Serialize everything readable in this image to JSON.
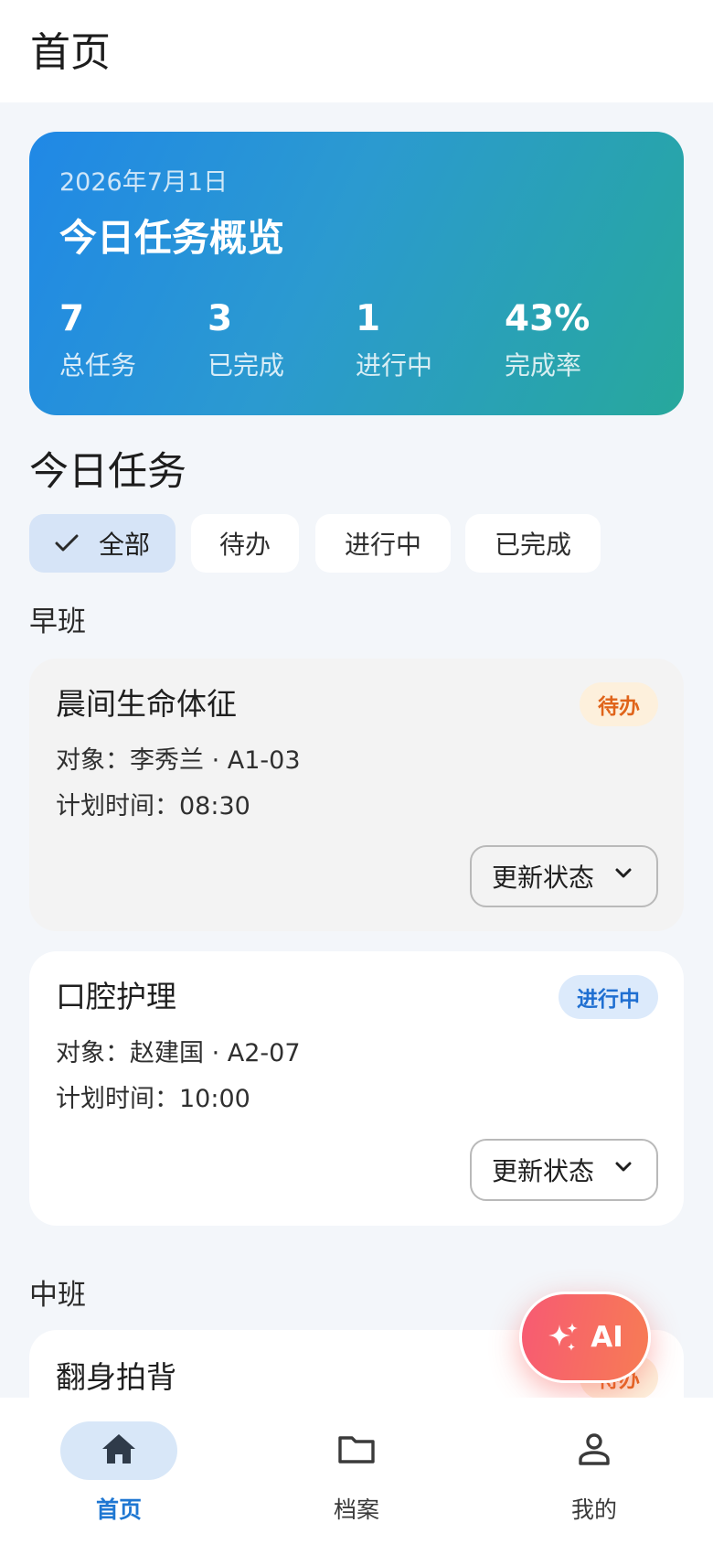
{
  "header": {
    "title": "首页"
  },
  "summary": {
    "date": "2026年7月1日",
    "heading": "今日任务概览",
    "stats": [
      {
        "value": "7",
        "label": "总任务"
      },
      {
        "value": "3",
        "label": "已完成"
      },
      {
        "value": "1",
        "label": "进行中"
      },
      {
        "value": "43%",
        "label": "完成率"
      }
    ]
  },
  "tasks_section": {
    "title": "今日任务",
    "filters": [
      {
        "label": "全部",
        "selected": true
      },
      {
        "label": "待办",
        "selected": false
      },
      {
        "label": "进行中",
        "selected": false
      },
      {
        "label": "已完成",
        "selected": false
      }
    ]
  },
  "groups": [
    {
      "label": "早班",
      "tasks": [
        {
          "name": "晨间生命体征",
          "status": "待办",
          "subject": "对象：李秀兰 · A1-03",
          "time": "计划时间：08:30",
          "action": "更新状态"
        },
        {
          "name": "口腔护理",
          "status": "进行中",
          "subject": "对象：赵建国 · A2-07",
          "time": "计划时间：10:00",
          "action": "更新状态"
        }
      ]
    },
    {
      "label": "中班",
      "tasks": [
        {
          "name": "翻身拍背",
          "status": "待办"
        }
      ]
    }
  ],
  "fab": {
    "label": "AI"
  },
  "bottom_nav": {
    "items": [
      {
        "label": "首页",
        "icon": "home-icon",
        "active": true
      },
      {
        "label": "档案",
        "icon": "folder-icon",
        "active": false
      },
      {
        "label": "我的",
        "icon": "person-icon",
        "active": false
      }
    ]
  },
  "colors": {
    "accent": "#1f77d2",
    "background": "#f3f6fa",
    "summary_gradient_start": "#2088e6",
    "summary_gradient_end": "#27a89c",
    "todo_badge": "#e0641a",
    "doing_badge": "#1f6fd1",
    "fab_gradient_start": "#f75a73",
    "fab_gradient_end": "#f77c54"
  }
}
